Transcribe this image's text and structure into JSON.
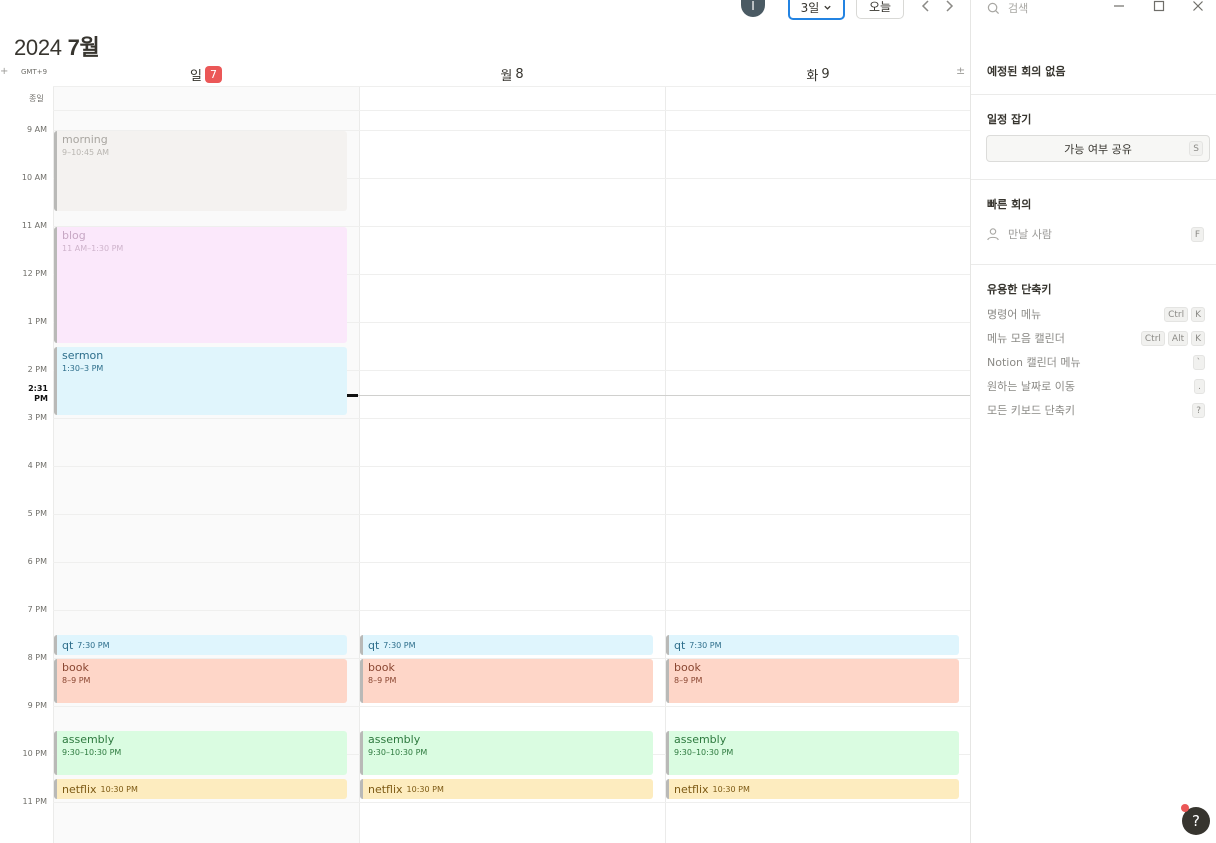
{
  "topbar": {
    "avatar_letter": "I",
    "view_label": "3일",
    "today_label": "오늘"
  },
  "header": {
    "year": "2024",
    "month": "7월",
    "add_label": "+",
    "timezone": "GMT+9",
    "allday_label": "종일",
    "more_label": "±",
    "days": [
      {
        "weekday": "일",
        "date": "7",
        "is_today": true
      },
      {
        "weekday": "월",
        "date": "8",
        "is_today": false
      },
      {
        "weekday": "화",
        "date": "9",
        "is_today": false
      }
    ]
  },
  "hours": [
    "9 AM",
    "10 AM",
    "11 AM",
    "12 PM",
    "1 PM",
    "2 PM",
    "3 PM",
    "4 PM",
    "5 PM",
    "6 PM",
    "7 PM",
    "8 PM",
    "9 PM",
    "10 PM",
    "11 PM"
  ],
  "now": {
    "label": "2:31 PM"
  },
  "events": [
    {
      "day": 0,
      "title": "morning",
      "time": "9–10:45 AM",
      "color": "morning",
      "inline": false
    },
    {
      "day": 0,
      "title": "blog",
      "time": "11 AM–1:30 PM",
      "color": "blog",
      "inline": false
    },
    {
      "day": 0,
      "title": "sermon",
      "time": "1:30–3 PM",
      "color": "sermon",
      "inline": false
    },
    {
      "day": 0,
      "title": "qt",
      "time": "7:30 PM",
      "color": "qt",
      "inline": true
    },
    {
      "day": 0,
      "title": "book",
      "time": "8–9 PM",
      "color": "book",
      "inline": false
    },
    {
      "day": 0,
      "title": "assembly",
      "time": "9:30–10:30 PM",
      "color": "assembly",
      "inline": false
    },
    {
      "day": 0,
      "title": "netflix",
      "time": "10:30 PM",
      "color": "netflix",
      "inline": true
    },
    {
      "day": 1,
      "title": "qt",
      "time": "7:30 PM",
      "color": "qt",
      "inline": true
    },
    {
      "day": 1,
      "title": "book",
      "time": "8–9 PM",
      "color": "book",
      "inline": false
    },
    {
      "day": 1,
      "title": "assembly",
      "time": "9:30–10:30 PM",
      "color": "assembly",
      "inline": false
    },
    {
      "day": 1,
      "title": "netflix",
      "time": "10:30 PM",
      "color": "netflix",
      "inline": true
    },
    {
      "day": 2,
      "title": "qt",
      "time": "7:30 PM",
      "color": "qt",
      "inline": true
    },
    {
      "day": 2,
      "title": "book",
      "time": "8–9 PM",
      "color": "book",
      "inline": false
    },
    {
      "day": 2,
      "title": "assembly",
      "time": "9:30–10:30 PM",
      "color": "assembly",
      "inline": false
    },
    {
      "day": 2,
      "title": "netflix",
      "time": "10:30 PM",
      "color": "netflix",
      "inline": true
    }
  ],
  "sidebar": {
    "search_placeholder": "검색",
    "no_meetings": "예정된 회의 없음",
    "schedule_title": "일정 잡기",
    "share_label": "가능 여부 공유",
    "share_key": "S",
    "quick_title": "빠른 회의",
    "meet_label": "만날 사람",
    "meet_key": "F",
    "shortcuts_title": "유용한 단축키",
    "shortcuts": [
      {
        "label": "명령어 메뉴",
        "keys": [
          "Ctrl",
          "K"
        ]
      },
      {
        "label": "메뉴 모음 캘린더",
        "keys": [
          "Ctrl",
          "Alt",
          "K"
        ]
      },
      {
        "label": "Notion 캘린더 메뉴",
        "keys": [
          "`"
        ]
      },
      {
        "label": "원하는 날짜로 이동",
        "keys": [
          "."
        ]
      },
      {
        "label": "모든 키보드 단축키",
        "keys": [
          "?"
        ]
      }
    ]
  },
  "help": {
    "label": "?"
  }
}
